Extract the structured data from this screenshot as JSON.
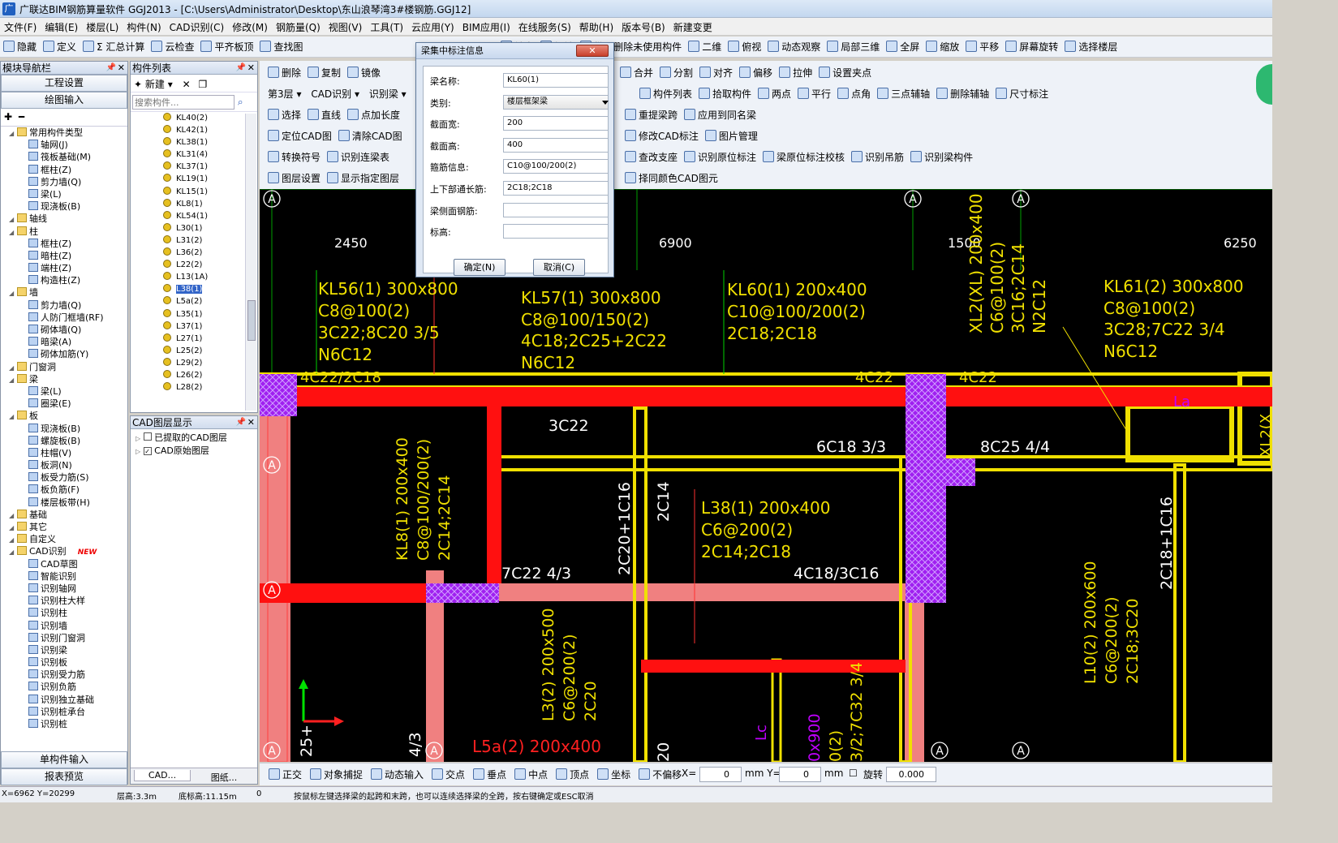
{
  "window": {
    "title": "广联达BIM钢筋算量软件 GGJ2013 - [C:\\Users\\Administrator\\Desktop\\东山浪琴湾3#楼钢筋.GGJ12]"
  },
  "menu": [
    "文件(F)",
    "编辑(E)",
    "楼层(L)",
    "构件(N)",
    "CAD识别(C)",
    "修改(M)",
    "钢筋量(Q)",
    "视图(V)",
    "工具(T)",
    "云应用(Y)",
    "BIM应用(I)",
    "在线服务(S)",
    "帮助(H)",
    "版本号(B)",
    "新建变更"
  ],
  "toolbar1": {
    "left": [
      "隐藏",
      "定义",
      "Σ 汇总计算",
      "云检查",
      "平齐板顶",
      "查找图"
    ],
    "right": [
      "锁定",
      "解锁",
      "批量删除未使用构件",
      "二维",
      "俯视",
      "动态观察",
      "局部三维",
      "全屏",
      "缩放",
      "平移",
      "屏幕旋转",
      "选择楼层"
    ]
  },
  "toolbar2": {
    "left": [
      "删除",
      "复制",
      "镜像"
    ],
    "right": [
      "合并",
      "分割",
      "对齐",
      "偏移",
      "拉伸",
      "设置夹点"
    ]
  },
  "toolbar3": {
    "floor": "第3层",
    "mode": "CAD识别",
    "sub": "识别梁",
    "right": [
      "构件列表",
      "拾取构件",
      "两点",
      "平行",
      "点角",
      "三点辅轴",
      "删除辅轴",
      "尺寸标注"
    ]
  },
  "toolbar4": {
    "left": [
      "选择",
      "直线",
      "点加长度"
    ],
    "right": [
      "重提梁跨",
      "应用到同名梁"
    ]
  },
  "toolbar5": {
    "left": [
      "定位CAD图",
      "清除CAD图"
    ],
    "right": [
      "修改CAD标注",
      "图片管理"
    ]
  },
  "toolbar6": {
    "left": [
      "转换符号",
      "识别连梁表"
    ],
    "right": [
      "查改支座",
      "识别原位标注",
      "梁原位标注校核",
      "识别吊筋",
      "识别梁构件"
    ]
  },
  "toolbar7": {
    "left": [
      "图层设置",
      "显示指定图层"
    ],
    "right": [
      "择同颜色CAD图元"
    ]
  },
  "nav": {
    "header": "模块导航栏",
    "btn_project": "工程设置",
    "btn_draw": "绘图输入",
    "btn_single": "单构件输入",
    "btn_report": "报表预览",
    "tree": [
      {
        "label": "常用构件类型",
        "level": 0,
        "folder": true
      },
      {
        "label": "轴网(J)",
        "level": 1
      },
      {
        "label": "筏板基础(M)",
        "level": 1
      },
      {
        "label": "框柱(Z)",
        "level": 1
      },
      {
        "label": "剪力墙(Q)",
        "level": 1
      },
      {
        "label": "梁(L)",
        "level": 1
      },
      {
        "label": "现浇板(B)",
        "level": 1
      },
      {
        "label": "轴线",
        "level": 0,
        "folder": true
      },
      {
        "label": "柱",
        "level": 0,
        "folder": true
      },
      {
        "label": "框柱(Z)",
        "level": 1
      },
      {
        "label": "暗柱(Z)",
        "level": 1
      },
      {
        "label": "端柱(Z)",
        "level": 1
      },
      {
        "label": "构造柱(Z)",
        "level": 1
      },
      {
        "label": "墙",
        "level": 0,
        "folder": true
      },
      {
        "label": "剪力墙(Q)",
        "level": 1
      },
      {
        "label": "人防门框墙(RF)",
        "level": 1
      },
      {
        "label": "砌体墙(Q)",
        "level": 1
      },
      {
        "label": "暗梁(A)",
        "level": 1
      },
      {
        "label": "砌体加筋(Y)",
        "level": 1
      },
      {
        "label": "门窗洞",
        "level": 0,
        "folder": true
      },
      {
        "label": "梁",
        "level": 0,
        "folder": true
      },
      {
        "label": "梁(L)",
        "level": 1
      },
      {
        "label": "圈梁(E)",
        "level": 1
      },
      {
        "label": "板",
        "level": 0,
        "folder": true
      },
      {
        "label": "现浇板(B)",
        "level": 1
      },
      {
        "label": "螺旋板(B)",
        "level": 1
      },
      {
        "label": "柱帽(V)",
        "level": 1
      },
      {
        "label": "板洞(N)",
        "level": 1
      },
      {
        "label": "板受力筋(S)",
        "level": 1
      },
      {
        "label": "板负筋(F)",
        "level": 1
      },
      {
        "label": "楼层板带(H)",
        "level": 1
      },
      {
        "label": "基础",
        "level": 0,
        "folder": true
      },
      {
        "label": "其它",
        "level": 0,
        "folder": true
      },
      {
        "label": "自定义",
        "level": 0,
        "folder": true
      },
      {
        "label": "CAD识别",
        "level": 0,
        "folder": true,
        "badge": "NEW"
      },
      {
        "label": "CAD草图",
        "level": 1
      },
      {
        "label": "智能识别",
        "level": 1
      },
      {
        "label": "识别轴网",
        "level": 1
      },
      {
        "label": "识别柱大样",
        "level": 1
      },
      {
        "label": "识别柱",
        "level": 1
      },
      {
        "label": "识别墙",
        "level": 1
      },
      {
        "label": "识别门窗洞",
        "level": 1
      },
      {
        "label": "识别梁",
        "level": 1
      },
      {
        "label": "识别板",
        "level": 1
      },
      {
        "label": "识别受力筋",
        "level": 1
      },
      {
        "label": "识别负筋",
        "level": 1
      },
      {
        "label": "识别独立基础",
        "level": 1
      },
      {
        "label": "识别桩承台",
        "level": 1
      },
      {
        "label": "识别桩",
        "level": 1
      }
    ]
  },
  "complist": {
    "header": "构件列表",
    "new_label": "新建",
    "search_placeholder": "搜索构件...",
    "items": [
      "KL40(2)",
      "KL42(1)",
      "KL38(1)",
      "KL31(4)",
      "KL37(1)",
      "KL19(1)",
      "KL15(1)",
      "KL8(1)",
      "KL54(1)",
      "L30(1)",
      "L31(2)",
      "L36(2)",
      "L22(2)",
      "L13(1A)",
      "L38(1)",
      "L5a(2)",
      "L35(1)",
      "L37(1)",
      "L27(1)",
      "L25(2)",
      "L29(2)",
      "L26(2)",
      "L28(2)"
    ],
    "selected_index": 14
  },
  "cadlayer": {
    "header": "CAD图层显示",
    "items": [
      "已提取的CAD图层",
      "CAD原始图层"
    ],
    "tab1": "CAD...",
    "tab2": "图纸..."
  },
  "dialog": {
    "title": "梁集中标注信息",
    "close": "✕",
    "fields": [
      {
        "label": "梁名称:",
        "value": "KL60(1)"
      },
      {
        "label": "类别:",
        "value": "楼层框架梁",
        "select": true
      },
      {
        "label": "截面宽:",
        "value": "200"
      },
      {
        "label": "截面高:",
        "value": "400"
      },
      {
        "label": "箍筋信息:",
        "value": "C10@100/200(2)"
      },
      {
        "label": "上下部通长筋:",
        "value": "2C18;2C18"
      },
      {
        "label": "梁侧面钢筋:",
        "value": ""
      },
      {
        "label": "标高:",
        "value": ""
      }
    ],
    "ok": "确定(N)",
    "cancel": "取消(C)"
  },
  "canvas": {
    "dims": [
      "2450",
      "6900",
      "1500",
      "6250"
    ],
    "axis_labels": [
      "A",
      "A",
      "A",
      "A",
      "A",
      "A",
      "A",
      "A",
      "A"
    ],
    "beams": {
      "kl56": [
        "KL56(1) 300x800",
        "C8@100(2)",
        "3C22;8C20 3/5",
        "N6C12"
      ],
      "kl57": [
        "KL57(1) 300x800",
        "C8@100/150(2)",
        "4C18;2C25+2C22",
        "N6C12"
      ],
      "kl60": [
        "KL60(1) 200x400",
        "C10@100/200(2)",
        "2C18;2C18"
      ],
      "kl61": [
        "KL61(2) 300x800",
        "C8@100(2)",
        "3C28;7C22 3/4",
        "N6C12"
      ],
      "xl2": [
        "XL2(XL) 200x400",
        "C6@100(2)",
        "3C16;2C14",
        "N2C12"
      ],
      "kl8": [
        "KL8(1) 200x400",
        "C8@100/200(2)",
        "2C14;2C14"
      ],
      "l38": [
        "L38(1) 200x400",
        "C6@200(2)",
        "2C14;2C18"
      ],
      "l3": [
        "L3(2) 200x500",
        "C6@200(2)",
        "2C20"
      ],
      "l10": [
        "L10(2) 200x600",
        "C6@200(2)",
        "2C18;3C20"
      ],
      "l5a": "L5a(2) 200x400"
    },
    "marks": [
      "4C22/2C18",
      "4C22",
      "4C22",
      "3C22",
      "6C18 3/3",
      "8C25 4/4",
      "7C22 4/3",
      "4C18/3C16",
      "2C20+1C16",
      "2C14",
      "2C18+1C16",
      "La",
      "Lc",
      "25+",
      "4/3",
      "20",
      "0x900",
      "0(2)",
      "3/2;7C32 3/4",
      "XL2(X"
    ]
  },
  "snapbar": {
    "items": [
      "正交",
      "对象捕捉",
      "动态输入",
      "交点",
      "垂点",
      "中点",
      "顶点",
      "坐标",
      "不偏移"
    ],
    "x_label": "X=",
    "x_value": "0",
    "y_label": "mm Y=",
    "y_value": "0",
    "mm": "mm",
    "rotate_label": "旋转",
    "rotate_value": "0.000"
  },
  "status": {
    "coords": "X=6962 Y=20299",
    "floor_height": "层高:3.3m",
    "bottom_elev": "底标高:11.15m",
    "zero": "0",
    "hint": "按鼠标左键选择梁的起跨和末跨，也可以连续选择梁的全跨，按右键确定或ESC取消"
  }
}
